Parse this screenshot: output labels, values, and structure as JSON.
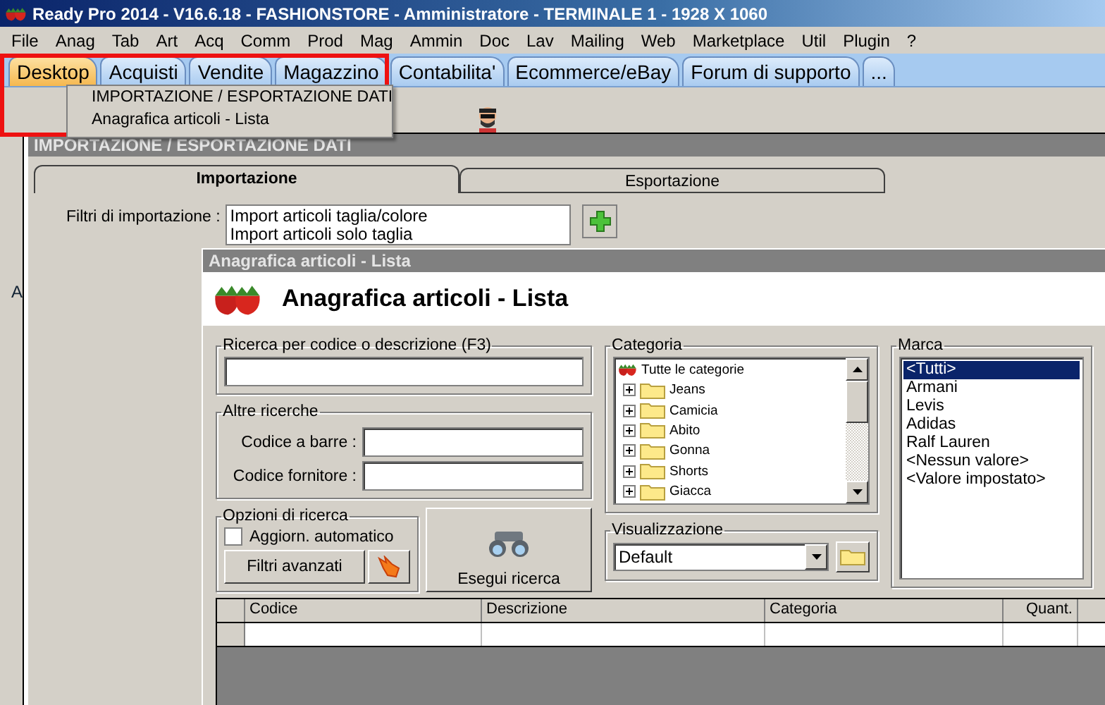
{
  "window": {
    "title": "Ready Pro 2014 - V16.6.18 - FASHIONSTORE - Amministratore - TERMINALE 1 - 1928 X 1060"
  },
  "menu_bar": [
    "File",
    "Anag",
    "Tab",
    "Art",
    "Acq",
    "Comm",
    "Prod",
    "Mag",
    "Ammin",
    "Doc",
    "Lav",
    "Mailing",
    "Web",
    "Marketplace",
    "Util",
    "Plugin",
    "?"
  ],
  "tabs": [
    {
      "label": "Desktop",
      "selected": true
    },
    {
      "label": "Acquisti",
      "selected": false
    },
    {
      "label": "Vendite",
      "selected": false
    },
    {
      "label": "Magazzino",
      "selected": false
    },
    {
      "label": "Contabilita'",
      "selected": false
    },
    {
      "label": "Ecommerce/eBay",
      "selected": false
    },
    {
      "label": "Forum di supporto",
      "selected": false
    },
    {
      "label": "...",
      "selected": false
    }
  ],
  "tab_menu": {
    "items": [
      "IMPORTAZIONE / ESPORTAZIONE DATI",
      "Anagrafica articoli  - Lista"
    ]
  },
  "desktop": {
    "label": "A"
  },
  "import_window": {
    "title": "IMPORTAZIONE / ESPORTAZIONE DATI",
    "tabs": [
      {
        "label": "Importazione",
        "selected": true
      },
      {
        "label": "Esportazione",
        "selected": false
      }
    ],
    "filter_label": "Filtri di importazione :",
    "filters": [
      "Import articoli taglia/colore",
      "Import articoli solo taglia"
    ]
  },
  "list_window": {
    "title": "Anagrafica articoli  - Lista",
    "heading": "Anagrafica articoli  - Lista",
    "search": {
      "legend": "Ricerca per codice o descrizione (F3)"
    },
    "other_search": {
      "legend": "Altre ricerche",
      "fields": [
        "Codice a barre :",
        "Codice fornitore :"
      ]
    },
    "options": {
      "legend": "Opzioni di ricerca",
      "auto_update": {
        "label": "Aggiorn. automatico",
        "checked": false
      },
      "advanced_button": "Filtri avanzati"
    },
    "search_button": "Esegui ricerca",
    "category": {
      "legend": "Categoria",
      "root": "Tutte le categorie",
      "children": [
        {
          "label": "Jeans",
          "expanded": false
        },
        {
          "label": "Camicia",
          "expanded": false
        },
        {
          "label": "Abito",
          "expanded": false
        },
        {
          "label": "Gonna",
          "expanded": false
        },
        {
          "label": "Shorts",
          "expanded": false
        },
        {
          "label": "Giacca",
          "expanded": false
        }
      ]
    },
    "view": {
      "legend": "Visualizzazione",
      "value": "Default"
    },
    "brand": {
      "legend": "Marca",
      "items": [
        {
          "label": "<Tutti>",
          "selected": true
        },
        {
          "label": "Armani",
          "selected": false
        },
        {
          "label": "Levis",
          "selected": false
        },
        {
          "label": "Adidas",
          "selected": false
        },
        {
          "label": "Ralf Lauren",
          "selected": false
        },
        {
          "label": "<Nessun valore>",
          "selected": false
        },
        {
          "label": "<Valore impostato>",
          "selected": false
        }
      ]
    },
    "table": {
      "columns": [
        "Codice",
        "Descrizione",
        "Categoria",
        "Quant."
      ]
    }
  }
}
